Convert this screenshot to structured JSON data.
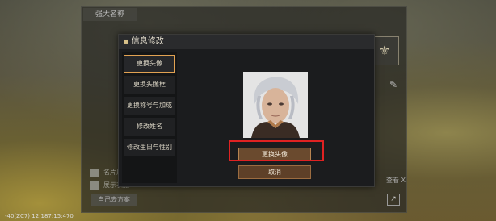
{
  "background": {
    "tab_label": "强大名称",
    "side_items": [
      "名片片",
      "展示衣服"
    ],
    "side_button": "自己去方案",
    "view_label": "查看 X",
    "status_line": "-40(ZC7) 12:187:15:470"
  },
  "dialog": {
    "title": "信息修改",
    "menu": [
      {
        "label": "更换头像",
        "active": true
      },
      {
        "label": "更换头像框",
        "active": false
      },
      {
        "label": "更换称号与加成",
        "active": false
      },
      {
        "label": "修改姓名",
        "active": false
      },
      {
        "label": "修改生日与性别",
        "active": false
      }
    ],
    "change_button": "更换头像",
    "cancel_button": "取消"
  },
  "colors": {
    "accent_orange": "#e2a252",
    "button_brown": "#6a4a2e",
    "highlight_red": "#e02222"
  }
}
